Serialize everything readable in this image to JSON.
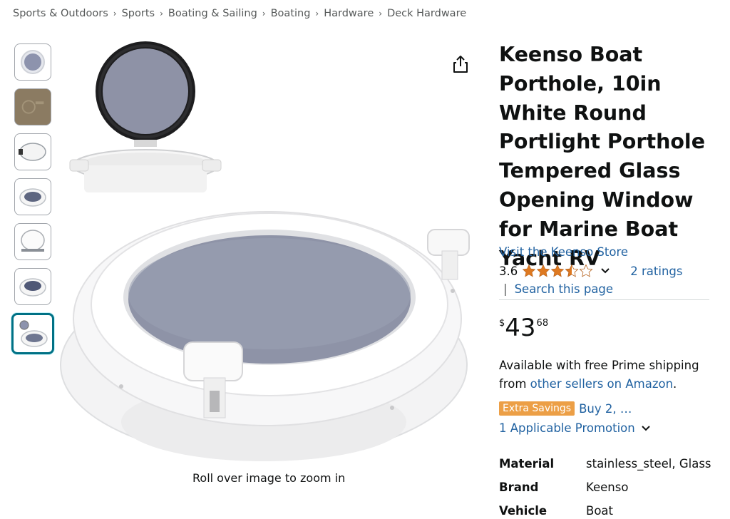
{
  "breadcrumb": [
    "Sports & Outdoors",
    "Sports",
    "Boating & Sailing",
    "Boating",
    "Hardware",
    "Deck Hardware"
  ],
  "breadcrumb_separator": "›",
  "product": {
    "title": "Keenso Boat Porthole, 10in White Round Portlight Porthole Tempered Glass Opening Window for Marine Boat Yacht RV",
    "store_link": "Visit the Keenso Store",
    "rating_value": "3.6",
    "rating_stars": 3.5,
    "ratings_count": "2 ratings",
    "search_link": "Search this page",
    "search_separator": "|",
    "price": {
      "symbol": "$",
      "whole": "43",
      "fraction": "68"
    },
    "availability": {
      "text": "Available with free Prime shipping from",
      "link": "other sellers on Amazon",
      "suffix": "."
    },
    "promo": {
      "badge": "Extra Savings",
      "text": "Buy 2, …",
      "applicable": "1 Applicable Promotion"
    },
    "specs": [
      {
        "key": "Material",
        "value": "stainless_steel, Glass"
      },
      {
        "key": "Brand",
        "value": "Keenso"
      },
      {
        "key": "Vehicle",
        "value": "Boat"
      }
    ]
  },
  "gallery": {
    "zoom_hint": "Roll over image to zoom in",
    "thumbnail_count": 7,
    "selected_index": 6
  },
  "colors": {
    "link": "#2162a1",
    "star": "#de7921",
    "badge": "#ec9f46",
    "selected_thumb": "#007185"
  },
  "icons": {
    "share": "share-icon",
    "star": "star-icon",
    "chevron": "chevron-down-icon"
  }
}
